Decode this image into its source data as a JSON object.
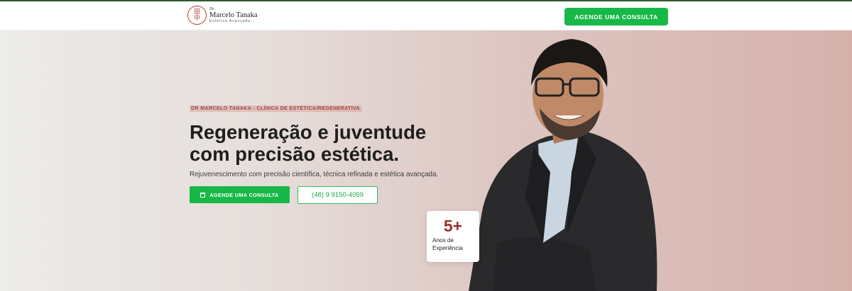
{
  "header": {
    "logo": {
      "mark": "田\n中",
      "prefix": "Dr.",
      "name": "Marcelo Tanaka",
      "subtitle": "Estética Avançada"
    },
    "cta_label": "AGENDE UMA CONSULTA"
  },
  "hero": {
    "eyebrow": "DR MARCELO TANAKA - CLÍNICA DE ESTÉTICA/REGENERATIVA",
    "headline": "Regeneração e juventude com precisão estética.",
    "subtext": "Rejuvenescimento com precisão científica, técnica refinada e estética avançada.",
    "primary_button": "AGENDE UMA CONSULTA",
    "phone_button": "(48) 9 9150-4059",
    "stat": {
      "value": "5+",
      "label": "Anos de Experiência"
    }
  },
  "colors": {
    "accent_green": "#18b848",
    "brand_red": "#9a2f2c",
    "top_border": "#2f5a2f"
  },
  "icons": [
    "calendar-icon"
  ]
}
